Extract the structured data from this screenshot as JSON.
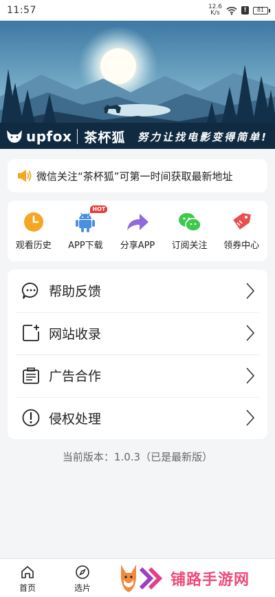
{
  "status_bar": {
    "time": "11:57",
    "net_speed_value": "12.6",
    "net_speed_unit": "K/s",
    "battery": "81"
  },
  "banner": {
    "brand_en": "upfox",
    "brand_cn": "茶杯狐",
    "slogan": "努力让找电影变得简单!"
  },
  "notice": {
    "text": "微信关注“茶杯狐”可第一时间获取最新地址"
  },
  "quick_actions": [
    {
      "label": "观看历史",
      "icon": "clock-icon",
      "color": "#f5a623"
    },
    {
      "label": "APP下载",
      "icon": "android-icon",
      "color": "#4a90e2",
      "badge": "HOT"
    },
    {
      "label": "分享APP",
      "icon": "share-arrow-icon",
      "color": "#8e6bd8"
    },
    {
      "label": "订阅关注",
      "icon": "wechat-icon",
      "color": "#3cc94c"
    },
    {
      "label": "领券中心",
      "icon": "coupon-tag-icon",
      "color": "#e8504d"
    }
  ],
  "menu": [
    {
      "label": "帮助反馈",
      "icon": "chat-bubble-icon"
    },
    {
      "label": "网站收录",
      "icon": "add-page-icon"
    },
    {
      "label": "广告合作",
      "icon": "ad-document-icon"
    },
    {
      "label": "侵权处理",
      "icon": "alert-circle-icon"
    }
  ],
  "version_text": "当前版本：1.0.3（已是最新版）",
  "tabbar": {
    "tabs": [
      {
        "label": "首页",
        "icon": "home-icon"
      },
      {
        "label": "选片",
        "icon": "compass-icon"
      }
    ]
  },
  "watermark": {
    "text": "铺路手游网"
  }
}
